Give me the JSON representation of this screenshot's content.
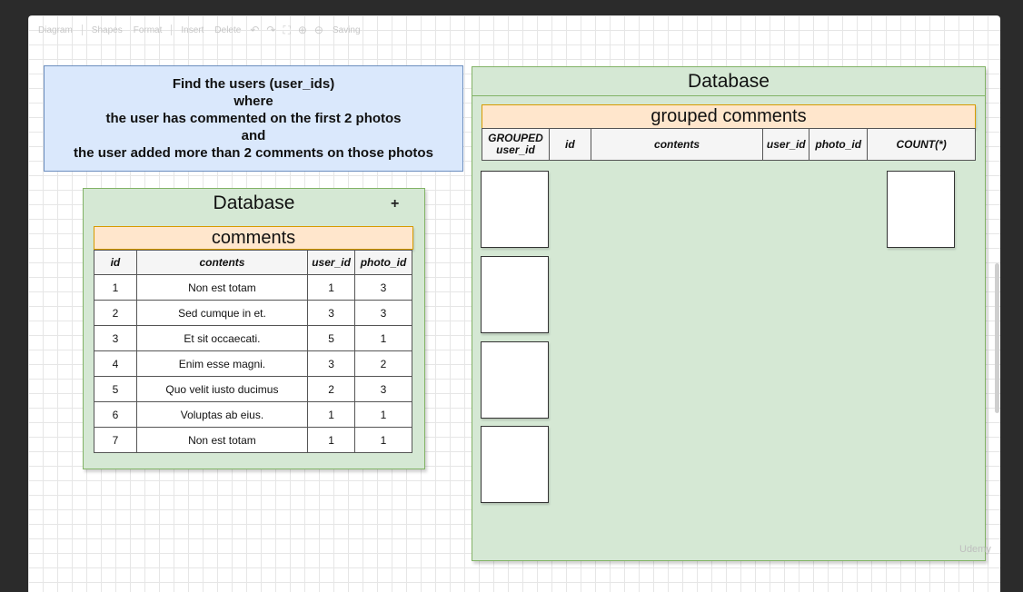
{
  "toolbar": {
    "items": [
      "Diagram",
      "Shapes",
      "Format",
      "Insert",
      "Delete",
      "Saving"
    ]
  },
  "task": {
    "lines": [
      "Find the users (user_ids)",
      "where",
      "the user has commented on the first 2 photos",
      "and",
      "the user added more than 2 comments on those photos"
    ]
  },
  "left_db": {
    "title": "Database",
    "add_icon": "+",
    "table_title": "comments",
    "columns": [
      "id",
      "contents",
      "user_id",
      "photo_id"
    ],
    "rows": [
      [
        "1",
        "Non est totam",
        "1",
        "3"
      ],
      [
        "2",
        "Sed cumque in et.",
        "3",
        "3"
      ],
      [
        "3",
        "Et sit occaecati.",
        "5",
        "1"
      ],
      [
        "4",
        "Enim esse magni.",
        "3",
        "2"
      ],
      [
        "5",
        "Quo velit iusto ducimus",
        "2",
        "3"
      ],
      [
        "6",
        "Voluptas ab eius.",
        "1",
        "1"
      ],
      [
        "7",
        "Non est totam",
        "1",
        "1"
      ]
    ]
  },
  "right_db": {
    "title": "Database",
    "table_title": "grouped comments",
    "columns": [
      "GROUPED user_id",
      "id",
      "contents",
      "user_id",
      "photo_id",
      "COUNT(*)"
    ]
  },
  "watermark": "Udemy"
}
